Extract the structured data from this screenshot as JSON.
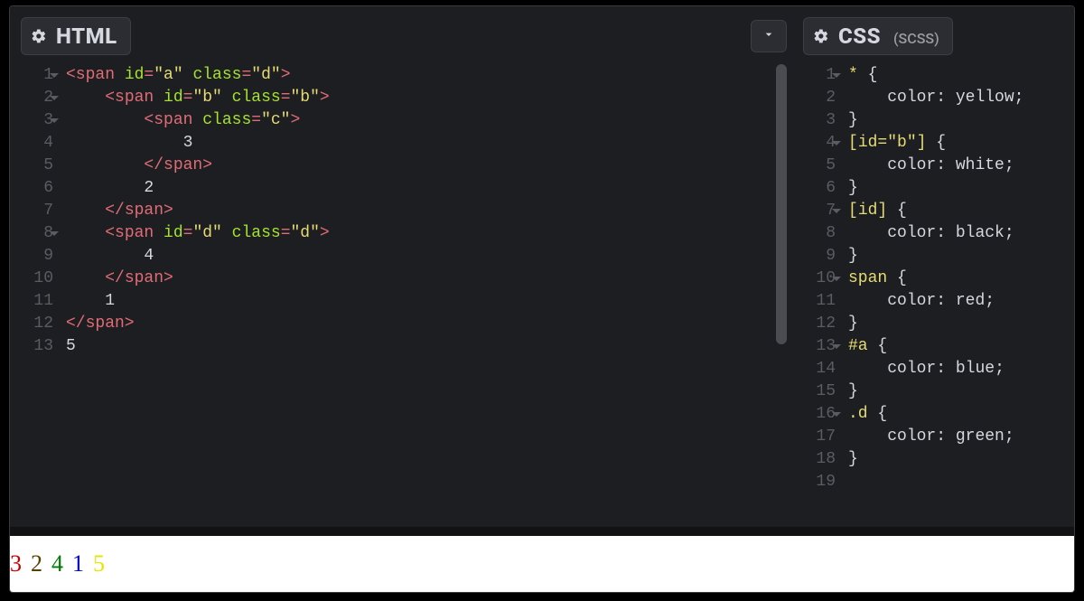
{
  "panes": {
    "html": {
      "title": "HTML",
      "subtitle": "",
      "gutter": [
        "1",
        "2",
        "3",
        "4",
        "5",
        "6",
        "7",
        "8",
        "9",
        "10",
        "11",
        "12",
        "13"
      ],
      "folds": [
        true,
        true,
        true,
        false,
        false,
        false,
        false,
        true,
        false,
        false,
        false,
        false,
        false
      ],
      "code_lines": [
        [
          {
            "t": "<span ",
            "c": "tag"
          },
          {
            "t": "id",
            "c": "attr"
          },
          {
            "t": "=",
            "c": "tag"
          },
          {
            "t": "\"a\"",
            "c": "str"
          },
          {
            "t": " ",
            "c": "plain"
          },
          {
            "t": "class",
            "c": "attr"
          },
          {
            "t": "=",
            "c": "tag"
          },
          {
            "t": "\"d\"",
            "c": "str"
          },
          {
            "t": ">",
            "c": "tag"
          }
        ],
        [
          {
            "t": "    ",
            "c": "plain"
          },
          {
            "t": "<span ",
            "c": "tag"
          },
          {
            "t": "id",
            "c": "attr"
          },
          {
            "t": "=",
            "c": "tag"
          },
          {
            "t": "\"b\"",
            "c": "str"
          },
          {
            "t": " ",
            "c": "plain"
          },
          {
            "t": "class",
            "c": "attr"
          },
          {
            "t": "=",
            "c": "tag"
          },
          {
            "t": "\"b\"",
            "c": "str"
          },
          {
            "t": ">",
            "c": "tag"
          }
        ],
        [
          {
            "t": "        ",
            "c": "plain"
          },
          {
            "t": "<span ",
            "c": "tag"
          },
          {
            "t": "class",
            "c": "attr"
          },
          {
            "t": "=",
            "c": "tag"
          },
          {
            "t": "\"c\"",
            "c": "str"
          },
          {
            "t": ">",
            "c": "tag"
          }
        ],
        [
          {
            "t": "            3",
            "c": "plain"
          }
        ],
        [
          {
            "t": "        ",
            "c": "plain"
          },
          {
            "t": "</span>",
            "c": "tag"
          }
        ],
        [
          {
            "t": "        2",
            "c": "plain"
          }
        ],
        [
          {
            "t": "    ",
            "c": "plain"
          },
          {
            "t": "</span>",
            "c": "tag"
          }
        ],
        [
          {
            "t": "    ",
            "c": "plain"
          },
          {
            "t": "<span ",
            "c": "tag"
          },
          {
            "t": "id",
            "c": "attr"
          },
          {
            "t": "=",
            "c": "tag"
          },
          {
            "t": "\"d\"",
            "c": "str"
          },
          {
            "t": " ",
            "c": "plain"
          },
          {
            "t": "class",
            "c": "attr"
          },
          {
            "t": "=",
            "c": "tag"
          },
          {
            "t": "\"d\"",
            "c": "str"
          },
          {
            "t": ">",
            "c": "tag"
          }
        ],
        [
          {
            "t": "        4",
            "c": "plain"
          }
        ],
        [
          {
            "t": "    ",
            "c": "plain"
          },
          {
            "t": "</span>",
            "c": "tag"
          }
        ],
        [
          {
            "t": "    1",
            "c": "plain"
          }
        ],
        [
          {
            "t": "</span>",
            "c": "tag"
          }
        ],
        [
          {
            "t": "5",
            "c": "plain"
          }
        ]
      ]
    },
    "css": {
      "title": "CSS",
      "subtitle": "(SCSS)",
      "gutter": [
        "1",
        "2",
        "3",
        "4",
        "5",
        "6",
        "7",
        "8",
        "9",
        "10",
        "11",
        "12",
        "13",
        "14",
        "15",
        "16",
        "17",
        "18",
        "19"
      ],
      "folds": [
        true,
        false,
        false,
        true,
        false,
        false,
        true,
        false,
        false,
        true,
        false,
        false,
        true,
        false,
        false,
        true,
        false,
        false,
        false
      ],
      "code_lines": [
        [
          {
            "t": "* ",
            "c": "selw"
          },
          {
            "t": "{",
            "c": "brace"
          }
        ],
        [
          {
            "t": "    ",
            "c": "plain"
          },
          {
            "t": "color",
            "c": "plain"
          },
          {
            "t": ": ",
            "c": "plain"
          },
          {
            "t": "yellow",
            "c": "plain"
          },
          {
            "t": ";",
            "c": "plain"
          }
        ],
        [
          {
            "t": "}",
            "c": "brace"
          }
        ],
        [
          {
            "t": "[",
            "c": "selw"
          },
          {
            "t": "id",
            "c": "selw"
          },
          {
            "t": "=",
            "c": "selw"
          },
          {
            "t": "\"b\"",
            "c": "str"
          },
          {
            "t": "] ",
            "c": "selw"
          },
          {
            "t": "{",
            "c": "brace"
          }
        ],
        [
          {
            "t": "    ",
            "c": "plain"
          },
          {
            "t": "color",
            "c": "plain"
          },
          {
            "t": ": ",
            "c": "plain"
          },
          {
            "t": "white",
            "c": "plain"
          },
          {
            "t": ";",
            "c": "plain"
          }
        ],
        [
          {
            "t": "}",
            "c": "brace"
          }
        ],
        [
          {
            "t": "[",
            "c": "selw"
          },
          {
            "t": "id",
            "c": "selw"
          },
          {
            "t": "] ",
            "c": "selw"
          },
          {
            "t": "{",
            "c": "brace"
          }
        ],
        [
          {
            "t": "    ",
            "c": "plain"
          },
          {
            "t": "color",
            "c": "plain"
          },
          {
            "t": ": ",
            "c": "plain"
          },
          {
            "t": "black",
            "c": "plain"
          },
          {
            "t": ";",
            "c": "plain"
          }
        ],
        [
          {
            "t": "}",
            "c": "brace"
          }
        ],
        [
          {
            "t": "span ",
            "c": "selw"
          },
          {
            "t": "{",
            "c": "brace"
          }
        ],
        [
          {
            "t": "    ",
            "c": "plain"
          },
          {
            "t": "color",
            "c": "plain"
          },
          {
            "t": ": ",
            "c": "plain"
          },
          {
            "t": "red",
            "c": "plain"
          },
          {
            "t": ";",
            "c": "plain"
          }
        ],
        [
          {
            "t": "}",
            "c": "brace"
          }
        ],
        [
          {
            "t": "#a ",
            "c": "selw"
          },
          {
            "t": "{",
            "c": "brace"
          }
        ],
        [
          {
            "t": "    ",
            "c": "plain"
          },
          {
            "t": "color",
            "c": "plain"
          },
          {
            "t": ": ",
            "c": "plain"
          },
          {
            "t": "blue",
            "c": "plain"
          },
          {
            "t": ";",
            "c": "plain"
          }
        ],
        [
          {
            "t": "}",
            "c": "brace"
          }
        ],
        [
          {
            "t": ".d ",
            "c": "selw"
          },
          {
            "t": "{",
            "c": "brace"
          }
        ],
        [
          {
            "t": "    ",
            "c": "plain"
          },
          {
            "t": "color",
            "c": "plain"
          },
          {
            "t": ": ",
            "c": "plain"
          },
          {
            "t": "green",
            "c": "plain"
          },
          {
            "t": ";",
            "c": "plain"
          }
        ],
        [
          {
            "t": "}",
            "c": "brace"
          }
        ],
        [
          {
            "t": " ",
            "c": "plain"
          }
        ]
      ]
    }
  },
  "output": [
    {
      "text": "3",
      "color": "#c80000"
    },
    {
      "text": "2",
      "color": "#5a4000"
    },
    {
      "text": "4",
      "color": "#007a00"
    },
    {
      "text": "1",
      "color": "#0000cc"
    },
    {
      "text": "5",
      "color": "#e6e600"
    }
  ]
}
